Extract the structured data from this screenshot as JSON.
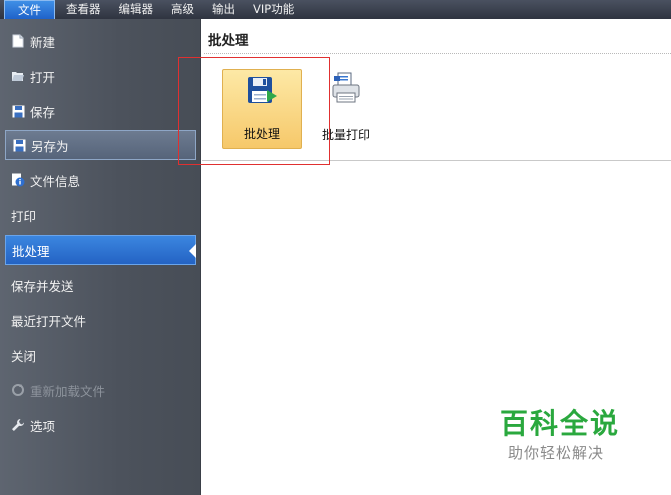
{
  "menubar": {
    "items": [
      {
        "label": "文件"
      },
      {
        "label": "查看器"
      },
      {
        "label": "编辑器"
      },
      {
        "label": "高级"
      },
      {
        "label": "输出"
      },
      {
        "label": "VIP功能"
      }
    ]
  },
  "sidebar": {
    "items": [
      {
        "label": "新建",
        "icon": "new-file-icon"
      },
      {
        "label": "打开",
        "icon": "open-folder-icon"
      },
      {
        "label": "保存",
        "icon": "save-disk-icon"
      },
      {
        "label": "另存为",
        "icon": "save-as-disk-icon"
      },
      {
        "label": "文件信息",
        "icon": "info-icon"
      },
      {
        "label": "打印"
      },
      {
        "label": "批处理"
      },
      {
        "label": "保存并发送"
      },
      {
        "label": "最近打开文件"
      },
      {
        "label": "关闭"
      },
      {
        "label": "重新加载文件",
        "icon": "reload-icon"
      },
      {
        "label": "选项",
        "icon": "wrench-icon"
      }
    ]
  },
  "panel": {
    "title": "批处理",
    "buttons": [
      {
        "label": "批处理",
        "icon": "batch-process-icon",
        "active": true
      },
      {
        "label": "批量打印",
        "icon": "batch-print-icon",
        "active": false
      }
    ]
  },
  "watermark": {
    "main": "百科全说",
    "sub": "助你轻松解决"
  },
  "colors": {
    "menubar": "#3a404c",
    "sidebar": "#555b65",
    "selected": "#2f74d4",
    "active_button": "#f6c86a",
    "highlight_box": "#e03030",
    "watermark": "#2aa83e"
  }
}
